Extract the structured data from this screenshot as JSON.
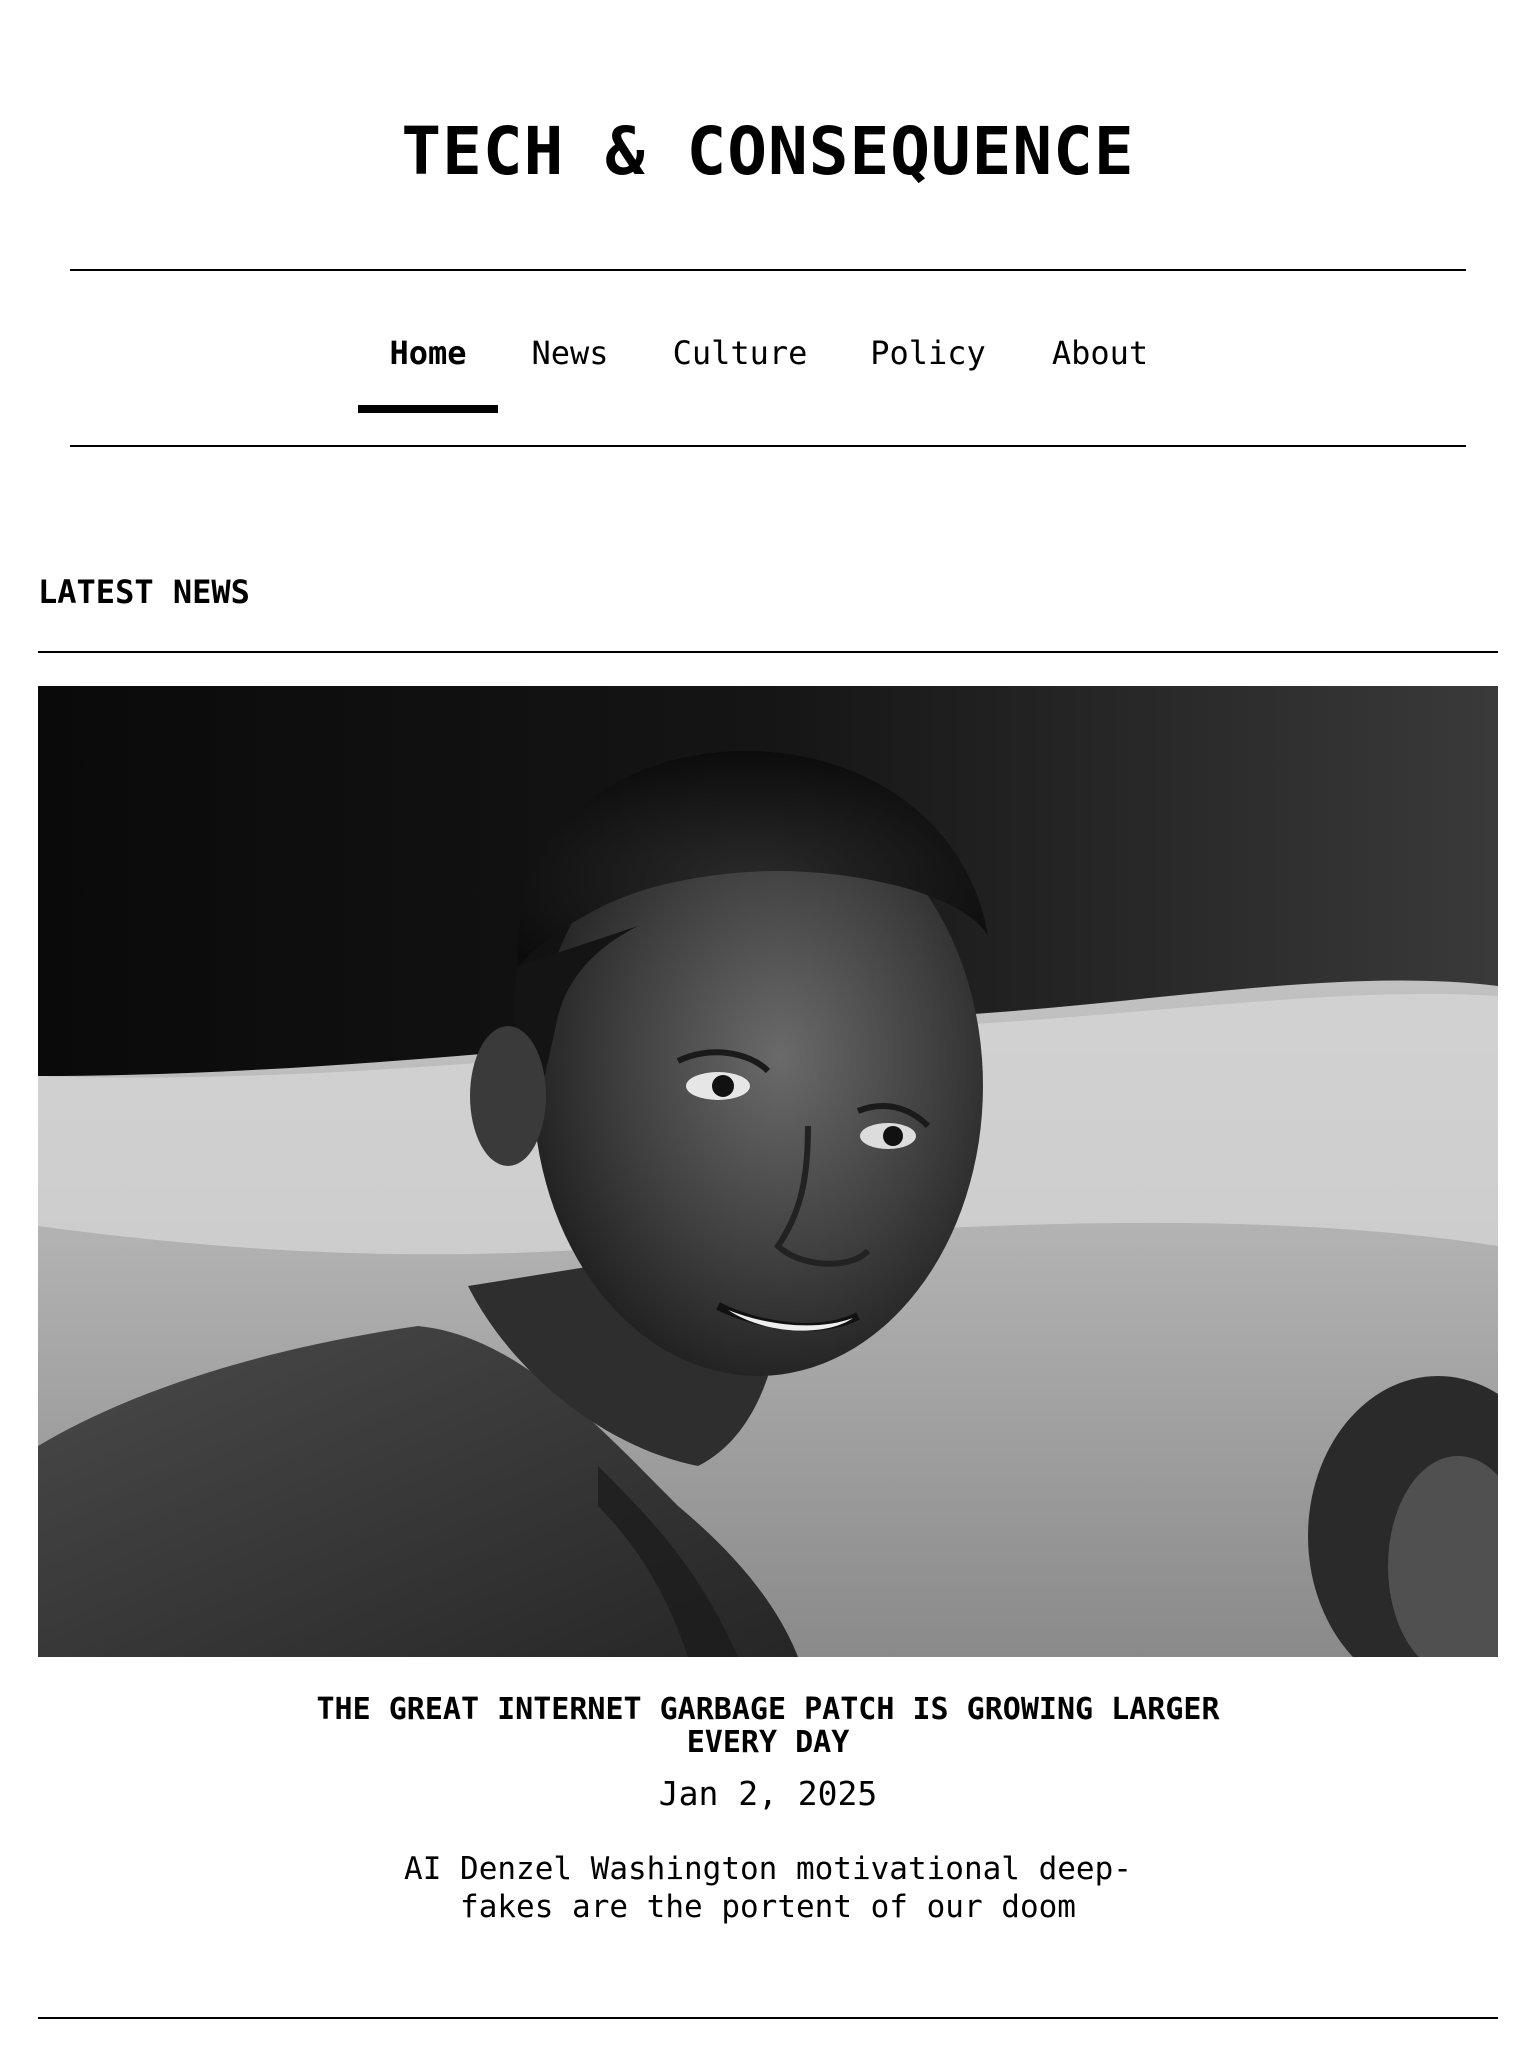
{
  "site": {
    "title": "TECH & CONSEQUENCE"
  },
  "nav": {
    "items": [
      {
        "label": "Home",
        "active": true
      },
      {
        "label": "News",
        "active": false
      },
      {
        "label": "Culture",
        "active": false
      },
      {
        "label": "Policy",
        "active": false
      },
      {
        "label": "About",
        "active": false
      }
    ]
  },
  "section": {
    "title": "LATEST NEWS"
  },
  "article": {
    "image": "black-and-white-portrait-photo",
    "title": "THE GREAT INTERNET GARBAGE PATCH IS GROWING LARGER EVERY DAY",
    "date": "Jan 2, 2025",
    "summary": "AI Denzel Washington motivational deep-fakes are the portent of our doom"
  }
}
